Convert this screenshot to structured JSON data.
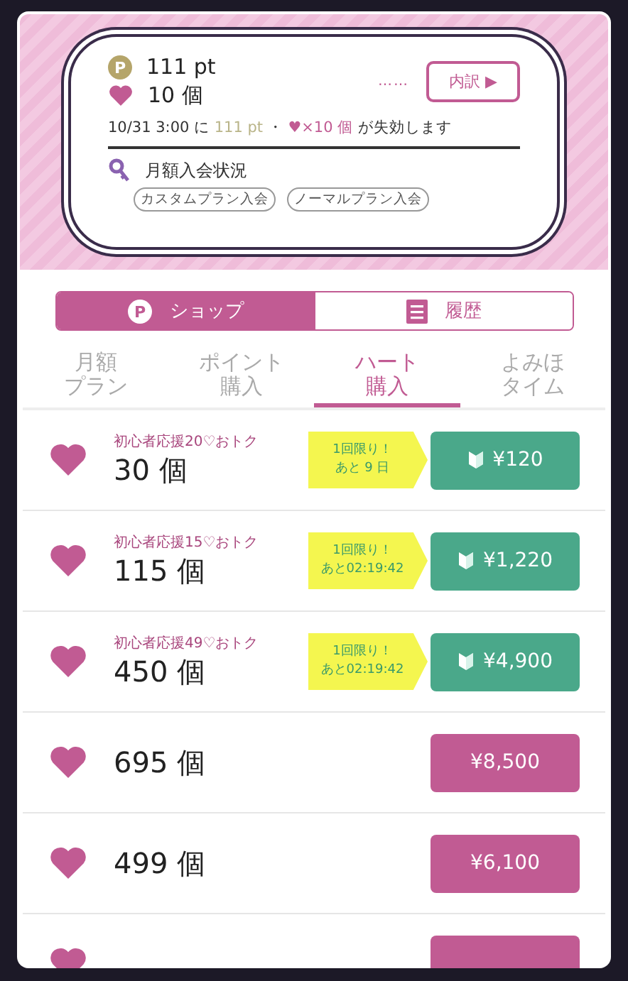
{
  "balance": {
    "coin": "P",
    "points": "111 pt",
    "hearts": "10 個",
    "dots": "……",
    "details_button": "内訳 ▶"
  },
  "expiry": [
    {
      "kind": "plain",
      "text": "10/31 3:00 に "
    },
    {
      "kind": "points",
      "text": "111 pt"
    },
    {
      "kind": "plain",
      "text": " ・ "
    },
    {
      "kind": "hearts",
      "text": "♥×10 個"
    },
    {
      "kind": "plain",
      "text": " が失効します"
    }
  ],
  "membership": {
    "label": "月額入会状況",
    "tags": [
      "カスタムプラン入会",
      "ノーマルプラン入会"
    ]
  },
  "main_tabs": [
    {
      "kind": "shop",
      "icon_text": "P",
      "label": "ショップ",
      "selected": true
    },
    {
      "kind": "history",
      "label": "履歴",
      "selected": false
    }
  ],
  "sub_tabs": [
    {
      "lines": [
        "月額",
        "プラン"
      ],
      "selected": false
    },
    {
      "lines": [
        "ポイント",
        "購入"
      ],
      "selected": false
    },
    {
      "lines": [
        "ハート",
        "購入"
      ],
      "selected": true
    },
    {
      "lines": [
        "よみほ",
        "タイム"
      ],
      "selected": false
    }
  ],
  "rows": [
    {
      "kind": "deal",
      "promo": "初心者応援20♡おトク",
      "amount": "30 個",
      "badge": [
        "1回限り！",
        "あと 9 日"
      ],
      "price": "¥120"
    },
    {
      "kind": "deal",
      "promo": "初心者応援15♡おトク",
      "amount": "115 個",
      "badge": [
        "1回限り！",
        "あと02:19:42"
      ],
      "price": "¥1,220"
    },
    {
      "kind": "deal",
      "promo": "初心者応援49♡おトク",
      "amount": "450 個",
      "badge": [
        "1回限り！",
        "あと02:19:42"
      ],
      "price": "¥4,900"
    },
    {
      "kind": "regular",
      "amount": "695 個",
      "price": "¥8,500"
    },
    {
      "kind": "regular",
      "amount": "499 個",
      "price": "¥6,100"
    }
  ],
  "more_below": true
}
